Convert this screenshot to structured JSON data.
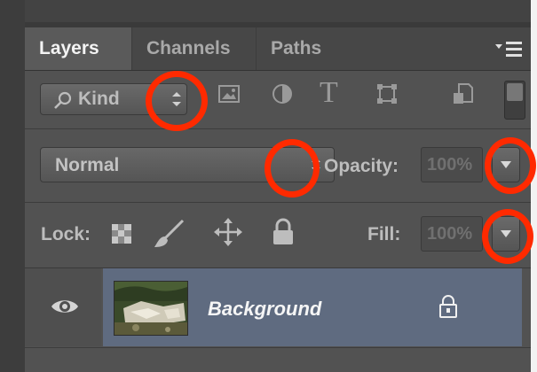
{
  "tabs": [
    {
      "label": "Layers",
      "active": true
    },
    {
      "label": "Channels",
      "active": false
    },
    {
      "label": "Paths",
      "active": false
    }
  ],
  "panel_menu_icon": "panel-menu-icon",
  "filter": {
    "kind_label": "Kind",
    "icons": [
      "pixel-layer-filter-icon",
      "adjustment-layer-filter-icon",
      "type-layer-filter-icon",
      "shape-layer-filter-icon",
      "smart-object-filter-icon"
    ],
    "type_glyph": "T"
  },
  "blend": {
    "mode": "Normal",
    "opacity_label": "Opacity:",
    "opacity_value": "100%"
  },
  "lock": {
    "label": "Lock:",
    "icons": [
      "lock-transparent-pixels-icon",
      "lock-image-pixels-icon",
      "lock-position-icon",
      "lock-all-icon"
    ],
    "fill_label": "Fill:",
    "fill_value": "100%"
  },
  "layers": [
    {
      "name": "Background",
      "visible": true,
      "locked": true
    }
  ],
  "colors": {
    "panel_bg": "#525252",
    "selected_layer": "#5f6b80",
    "annotation": "#ff2a00"
  }
}
